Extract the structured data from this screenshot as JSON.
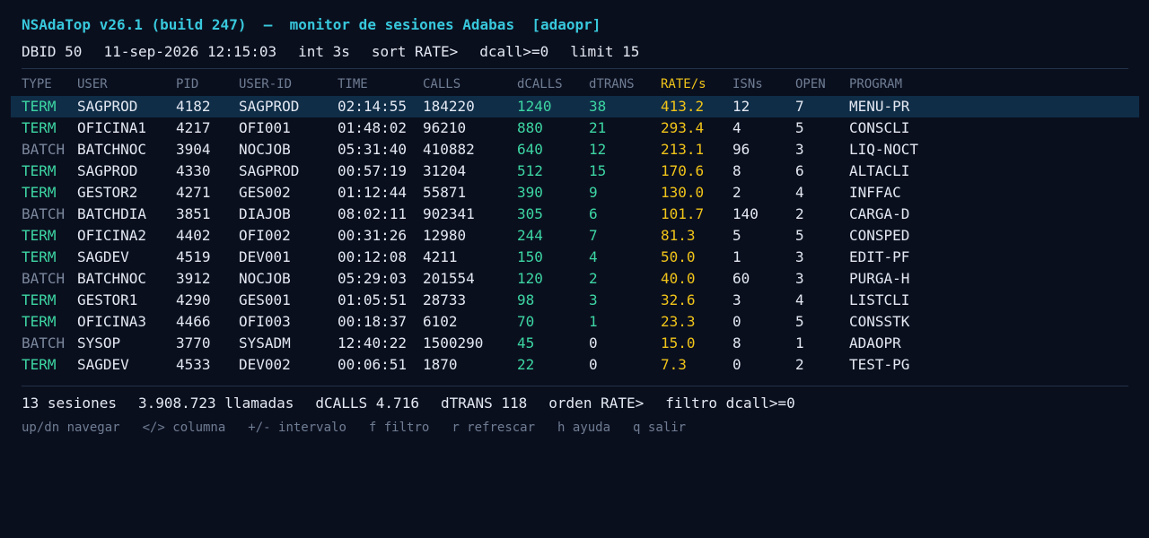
{
  "app": {
    "title": "NSAdaTop v26.1 (build 247)  —  monitor de sesiones Adabas  [adaopr]"
  },
  "status": {
    "dbid": "DBID 50",
    "datetime": "11-sep-2026 12:15:03",
    "interval": "int 3s",
    "sort": "sort RATE>",
    "filter": "dcall>=0",
    "limit": "limit 15"
  },
  "columns": [
    "TYPE",
    "USER",
    "PID",
    "USER-ID",
    "TIME",
    "CALLS",
    "dCALLS",
    "dTRANS",
    "RATE/s",
    "ISNs",
    "OPEN",
    "PROGRAM"
  ],
  "rows": [
    {
      "type": "TERM",
      "user": "SAGPROD",
      "pid": "4182",
      "uid": "SAGPROD",
      "time": "02:14:55",
      "calls": "184220",
      "dcalls": "1240",
      "dtrans": "38",
      "rate": "413.2",
      "isns": "12",
      "open": "7",
      "prog": "MENU-PR",
      "selected": true
    },
    {
      "type": "TERM",
      "user": "OFICINA1",
      "pid": "4217",
      "uid": "OFI001",
      "time": "01:48:02",
      "calls": "96210",
      "dcalls": "880",
      "dtrans": "21",
      "rate": "293.4",
      "isns": "4",
      "open": "5",
      "prog": "CONSCLI"
    },
    {
      "type": "BATCH",
      "user": "BATCHNOC",
      "pid": "3904",
      "uid": "NOCJOB",
      "time": "05:31:40",
      "calls": "410882",
      "dcalls": "640",
      "dtrans": "12",
      "rate": "213.1",
      "isns": "96",
      "open": "3",
      "prog": "LIQ-NOCT"
    },
    {
      "type": "TERM",
      "user": "SAGPROD",
      "pid": "4330",
      "uid": "SAGPROD",
      "time": "00:57:19",
      "calls": "31204",
      "dcalls": "512",
      "dtrans": "15",
      "rate": "170.6",
      "isns": "8",
      "open": "6",
      "prog": "ALTACLI"
    },
    {
      "type": "TERM",
      "user": "GESTOR2",
      "pid": "4271",
      "uid": "GES002",
      "time": "01:12:44",
      "calls": "55871",
      "dcalls": "390",
      "dtrans": "9",
      "rate": "130.0",
      "isns": "2",
      "open": "4",
      "prog": "INFFAC"
    },
    {
      "type": "BATCH",
      "user": "BATCHDIA",
      "pid": "3851",
      "uid": "DIAJOB",
      "time": "08:02:11",
      "calls": "902341",
      "dcalls": "305",
      "dtrans": "6",
      "rate": "101.7",
      "isns": "140",
      "open": "2",
      "prog": "CARGA-D"
    },
    {
      "type": "TERM",
      "user": "OFICINA2",
      "pid": "4402",
      "uid": "OFI002",
      "time": "00:31:26",
      "calls": "12980",
      "dcalls": "244",
      "dtrans": "7",
      "rate": "81.3",
      "isns": "5",
      "open": "5",
      "prog": "CONSPED"
    },
    {
      "type": "TERM",
      "user": "SAGDEV",
      "pid": "4519",
      "uid": "DEV001",
      "time": "00:12:08",
      "calls": "4211",
      "dcalls": "150",
      "dtrans": "4",
      "rate": "50.0",
      "isns": "1",
      "open": "3",
      "prog": "EDIT-PF"
    },
    {
      "type": "BATCH",
      "user": "BATCHNOC",
      "pid": "3912",
      "uid": "NOCJOB",
      "time": "05:29:03",
      "calls": "201554",
      "dcalls": "120",
      "dtrans": "2",
      "rate": "40.0",
      "isns": "60",
      "open": "3",
      "prog": "PURGA-H"
    },
    {
      "type": "TERM",
      "user": "GESTOR1",
      "pid": "4290",
      "uid": "GES001",
      "time": "01:05:51",
      "calls": "28733",
      "dcalls": "98",
      "dtrans": "3",
      "rate": "32.6",
      "isns": "3",
      "open": "4",
      "prog": "LISTCLI"
    },
    {
      "type": "TERM",
      "user": "OFICINA3",
      "pid": "4466",
      "uid": "OFI003",
      "time": "00:18:37",
      "calls": "6102",
      "dcalls": "70",
      "dtrans": "1",
      "rate": "23.3",
      "isns": "0",
      "open": "5",
      "prog": "CONSSTK"
    },
    {
      "type": "BATCH",
      "user": "SYSOP",
      "pid": "3770",
      "uid": "SYSADM",
      "time": "12:40:22",
      "calls": "1500290",
      "dcalls": "45",
      "dtrans": "0",
      "rate": "15.0",
      "isns": "8",
      "open": "1",
      "prog": "ADAOPR"
    },
    {
      "type": "TERM",
      "user": "SAGDEV",
      "pid": "4533",
      "uid": "DEV002",
      "time": "00:06:51",
      "calls": "1870",
      "dcalls": "22",
      "dtrans": "0",
      "rate": "7.3",
      "isns": "0",
      "open": "2",
      "prog": "TEST-PG"
    }
  ],
  "summary": {
    "sessions": "13 sesiones",
    "calls": "3.908.723 llamadas",
    "dcalls": "dCALLS 4.716",
    "dtrans": "dTRANS 118",
    "order": "orden RATE>",
    "filter": "filtro dcall>=0"
  },
  "keys": [
    "up/dn navegar",
    "</> columna",
    "+/- intervalo",
    "f filtro",
    "r refrescar",
    "h ayuda",
    "q salir"
  ],
  "colors": {
    "background": "#0a0f1e",
    "title": "#38c8dc",
    "term": "#3dd6a3",
    "batch": "#7a879c",
    "rate": "#f0c419",
    "selection": "#0f2d47"
  }
}
